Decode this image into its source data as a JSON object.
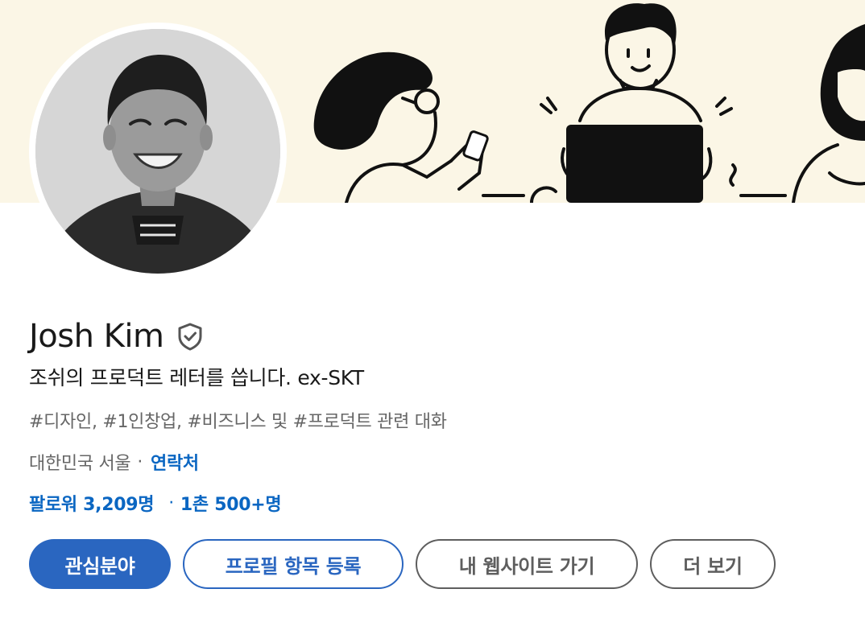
{
  "profile": {
    "name": "Josh Kim",
    "headline": "조쉬의 프로덕트 레터를 씁니다. ex-SKT",
    "topics": "#디자인, #1인창업, #비즈니스 및 #프로덕트 관련 대화",
    "location": "대한민국 서울",
    "contact_link": "연락처",
    "followers": "팔로워 3,209명",
    "connections": "1촌 500+명",
    "location_separator": "·",
    "stats_separator": "·"
  },
  "icons": {
    "verified": "verified-shield-icon"
  },
  "actions": {
    "interests_label": "관심분야",
    "add_section_label": "프로필 항목 등록",
    "website_label": "내 웹사이트 가기",
    "more_label": "더 보기"
  },
  "colors": {
    "brand_blue": "#0a66c2",
    "button_blue": "#2a66c0",
    "banner_bg": "#fbf6e6",
    "secondary_text": "#666666"
  }
}
